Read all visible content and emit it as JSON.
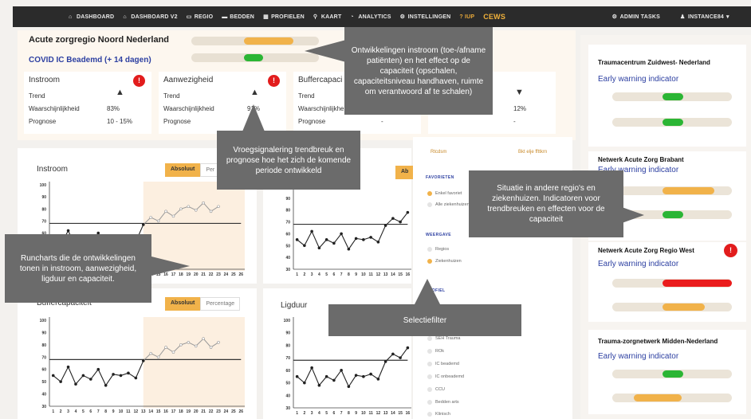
{
  "nav": {
    "items": [
      {
        "label": "DASHBOARD",
        "icon": "home-icon"
      },
      {
        "label": "DASHBOARD V2",
        "icon": "home-icon"
      },
      {
        "label": "REGIO",
        "icon": "monitor-icon"
      },
      {
        "label": "BEDDEN",
        "icon": "bed-icon"
      },
      {
        "label": "PROFIELEN",
        "icon": "grid-icon"
      },
      {
        "label": "KAART",
        "icon": "pin-icon"
      },
      {
        "label": "ANALYTICS",
        "icon": "chart-icon"
      },
      {
        "label": "INSTELLINGEN",
        "icon": "gear-icon"
      },
      {
        "label": "? IUP",
        "icon": ""
      },
      {
        "label": "CEWS",
        "icon": ""
      }
    ],
    "admin_tasks": "ADMIN TASKS",
    "user": "INSTANCE84"
  },
  "region": {
    "title": "Acute zorgregio Noord Nederland",
    "subtitle": "COVID IC Beademd (+ 14 dagen)"
  },
  "kpis": [
    {
      "title": "Instroom",
      "trend_label": "Trend",
      "prob_label": "Waarschijnlijkheid",
      "prob": "83%",
      "prog_label": "Prognose",
      "prog": "10 - 15%",
      "alert": "!"
    },
    {
      "title": "Aanwezigheid",
      "trend_label": "Trend",
      "prob_label": "Waarschijnlijkheid",
      "prob": "91%",
      "prog_label": "Prognose",
      "prog": "",
      "alert": "!"
    },
    {
      "title": "Buffercapaci",
      "trend_label": "Trend",
      "prob_label": "Waarschijnlijkheid",
      "prob": "",
      "prog_label": "Prognose",
      "prog": "-"
    },
    {
      "title": "",
      "trend_label": "",
      "prob_label": "",
      "prob": "12%",
      "prog_label": "",
      "prog": "-"
    }
  ],
  "charts": [
    {
      "title": "Instroom",
      "toggle_on": "Absoluut",
      "toggle_off": "Per"
    },
    {
      "title": "",
      "toggle_on": "Ab",
      "toggle_off": ""
    },
    {
      "title": "Buffercapaciteit",
      "toggle_on": "Absoluut",
      "toggle_off": "Percentage"
    },
    {
      "title": "Ligduur",
      "toggle_on": "",
      "toggle_off": ""
    }
  ],
  "chart_axis": {
    "y_ticks": [
      "100",
      "90",
      "80",
      "70",
      "60",
      "50",
      "40",
      "30"
    ],
    "x_ticks": [
      "1",
      "2",
      "3",
      "4",
      "5",
      "6",
      "7",
      "8",
      "9",
      "10",
      "11",
      "12",
      "13",
      "14",
      "15",
      "16",
      "17",
      "18",
      "19",
      "20",
      "21",
      "22",
      "23",
      "24",
      "25",
      "26"
    ]
  },
  "chart_data": [
    {
      "type": "line",
      "title": "Instroom",
      "x": [
        1,
        2,
        3,
        4,
        5,
        6,
        7,
        8,
        9,
        10,
        11,
        12,
        13,
        14,
        15,
        16,
        17,
        18,
        19,
        20,
        21,
        22,
        23
      ],
      "series": [
        {
          "values": [
            55,
            50,
            62,
            48,
            55,
            52,
            60,
            47,
            56,
            55,
            57,
            53,
            67,
            73,
            70,
            78,
            74,
            80,
            82,
            79,
            85,
            78,
            82
          ]
        }
      ],
      "ylim": [
        30,
        100
      ],
      "reference": 68
    },
    {
      "type": "line",
      "x": [
        1,
        2,
        3,
        4,
        5,
        6,
        7,
        8,
        9,
        10,
        11,
        12,
        13,
        14,
        15,
        16,
        17,
        18,
        19,
        20,
        21,
        22,
        23
      ],
      "series": [
        {
          "values": [
            55,
            50,
            62,
            48,
            55,
            52,
            60,
            47,
            56,
            55,
            57,
            53,
            67,
            73,
            70,
            78,
            74,
            80,
            82,
            79,
            85,
            78,
            82
          ]
        }
      ],
      "ylim": [
        30,
        100
      ],
      "reference": 68
    },
    {
      "type": "line",
      "title": "Buffercapaciteit",
      "x": [
        1,
        2,
        3,
        4,
        5,
        6,
        7,
        8,
        9,
        10,
        11,
        12,
        13,
        14,
        15,
        16,
        17,
        18,
        19,
        20,
        21,
        22,
        23
      ],
      "series": [
        {
          "values": [
            55,
            50,
            62,
            48,
            55,
            52,
            60,
            47,
            56,
            55,
            57,
            53,
            67,
            73,
            70,
            78,
            74,
            80,
            82,
            79,
            85,
            78,
            82
          ]
        }
      ],
      "ylim": [
        30,
        100
      ],
      "reference": 68
    },
    {
      "type": "line",
      "title": "Ligduur",
      "x": [
        1,
        2,
        3,
        4,
        5,
        6,
        7,
        8,
        9,
        10,
        11,
        12,
        13,
        14,
        15,
        16,
        17,
        18,
        19,
        20,
        21,
        22,
        23
      ],
      "series": [
        {
          "values": [
            55,
            50,
            62,
            48,
            55,
            52,
            60,
            47,
            56,
            55,
            57,
            53,
            67,
            73,
            70,
            78,
            74,
            80,
            82,
            79,
            85,
            78,
            82
          ]
        }
      ],
      "ylim": [
        30,
        100
      ],
      "reference": 68
    }
  ],
  "filter": {
    "tab_left": "Rtcdsm",
    "tab_right": "Bkt elje ffttkrn",
    "section_fav": "FAVORIETEN",
    "fav_options": [
      "Enkel favoriet",
      "Alle ziekenhuizen"
    ],
    "section_weergave": "WEERGAVE",
    "weergave_options": [
      "Regios",
      "Ziekenhuizen"
    ],
    "section_profiel": "PROFIEL",
    "profiel_options": [
      "SEH Trauma",
      "ROk",
      "IC beademd",
      "IC onbeademd",
      "CCU",
      "Bedden arts",
      "Klinisch"
    ]
  },
  "networks": [
    {
      "name": "Traumacentrum Zuidwest- Nederland",
      "ew": "Early warning indicator",
      "bars": [
        {
          "color": "#2bb534",
          "start": 0.42,
          "width": 0.17
        },
        {
          "color": "#2bb534",
          "start": 0.42,
          "width": 0.17
        }
      ],
      "alert": ""
    },
    {
      "name": "Netwerk Acute Zorg Brabant",
      "ew": "Early warning indicator",
      "bars": [
        {
          "color": "#f1b24a",
          "start": 0.42,
          "width": 0.43
        },
        {
          "color": "#2bb534",
          "start": 0.42,
          "width": 0.17
        }
      ],
      "alert": ""
    },
    {
      "name": "Netwerk Acute Zorg Regio West",
      "ew": "Early warning indicator",
      "bars": [
        {
          "color": "#ea1c1c",
          "start": 0.42,
          "width": 0.58
        },
        {
          "color": "#f1b24a",
          "start": 0.42,
          "width": 0.35
        }
      ],
      "alert": "!"
    },
    {
      "name": "Trauma-zorgnetwerk Midden-Nederland",
      "ew": "Early warning indicator",
      "bars": [
        {
          "color": "#2bb534",
          "start": 0.42,
          "width": 0.17
        },
        {
          "color": "#f1b24a",
          "start": 0.18,
          "width": 0.4
        }
      ],
      "alert": ""
    }
  ],
  "callouts": {
    "instroom": "Ontwikkelingen instroom (toe-/afname patiënten) en het effect op de capaciteit (opschalen, capaciteitsniveau handhaven, ruimte om verantwoord af te schalen)",
    "vroeg": "Vroegsignalering trendbreuk en prognose hoe het zich de komende periode ontwikkeld",
    "regios": "Situatie in andere regio's en ziekenhuizen. Indicatoren voor trendbreuken en effecten voor de capaciteit",
    "runcharts": "Runcharts die de ontwikkelingen tonen in instroom, aanwezigheid, ligduur en capaciteit.",
    "selectie": "Selectiefilter"
  },
  "colors": {
    "green": "#2bb534",
    "orange": "#f1b24a",
    "red": "#ea1c1c",
    "blue": "#2c3fa1"
  }
}
